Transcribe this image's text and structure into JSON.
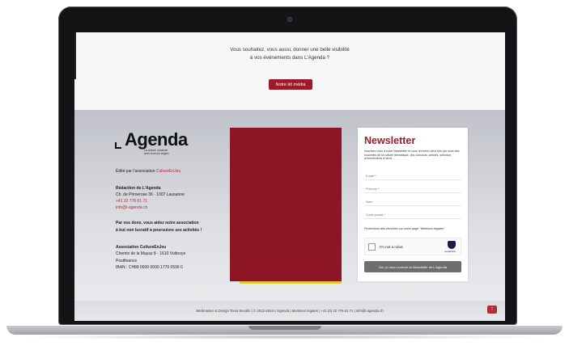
{
  "promo": {
    "line1": "Vous souhaitez, vous aussi, donner une belle visibilité",
    "line2": "à vos événements dans L'Agenda ?",
    "button": "Notre kit média"
  },
  "footer": {
    "logo_word": "Agenda",
    "logo_sub1": "La culture romande",
    "logo_sub2": "avec tous les angles",
    "edited_prefix": "Édité par l'association ",
    "edited_link": "CultureEnJeu",
    "redaction_title": "Rédaction de L'Agenda",
    "address": "Ch. de Primerose 36 · 1007 Lausanne",
    "phone": "+41 22 776 61 71",
    "email": "info@l-agenda.ch",
    "donation_l1": "Par vos dons, vous aidez notre association",
    "donation_l2": "à but non lucratif à poursuivre ses activités !",
    "assoc_title": "Association CultureEnJeu",
    "assoc_address": "Chemin de la Mayaz 8 · 1610 Vuibroye",
    "bank": "Postfinance",
    "iban": "IBAN : CH88 0900 0000 1770 0596 0"
  },
  "newsletter": {
    "title": "Newsletter",
    "description": "Inscrivez-vous à notre Newsletter et vous recevrez deux fois par mois des nouvelles de la culture thématique, des concours, articles, sélection d'événements à venir,...",
    "email_placeholder": "Email *",
    "firstname_placeholder": "Prénom *",
    "lastname_placeholder": "Nom",
    "zip_placeholder": "Code postal *",
    "privacy": "Protections des données sur notre page \"Mentions légales\"",
    "captcha_text": "I'm not a robot",
    "captcha_brand": "reCaptcha",
    "submit": "Oui, je veux recevoir la Newsletter de L'Agenda"
  },
  "bottombar": {
    "credits": "Webmaster & Design Tonia Secalin | © 2013-2024 L'Agenda | Mentions légales | +41 (0) 22 776 61 71 | info@l-agenda.ch",
    "up_icon": "↑"
  },
  "colors": {
    "brand_red": "#9b1b2a",
    "block_red": "#8e1525"
  }
}
